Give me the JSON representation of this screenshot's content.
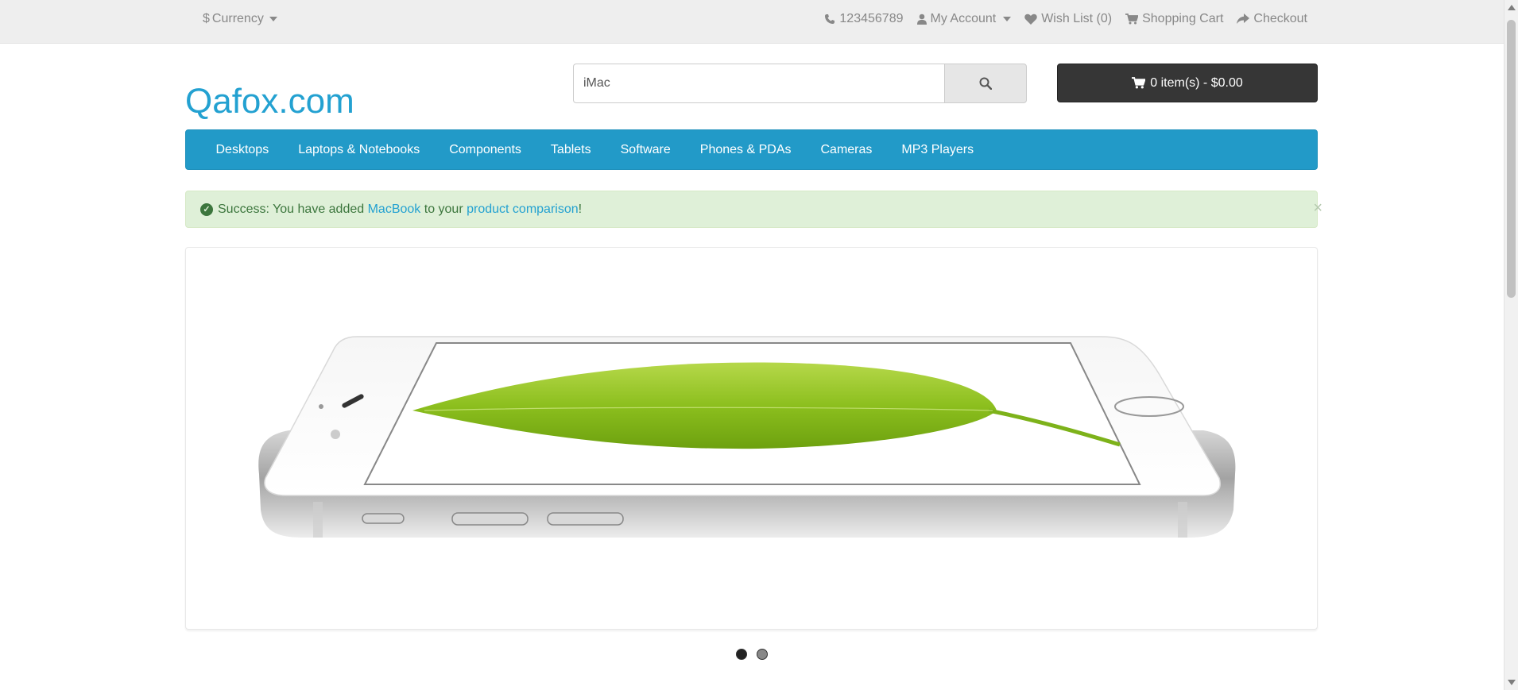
{
  "topbar": {
    "currency_symbol": "$",
    "currency_label": "Currency",
    "phone": "123456789",
    "my_account": "My Account",
    "wishlist": "Wish List (0)",
    "shopping_cart": "Shopping Cart",
    "checkout": "Checkout"
  },
  "header": {
    "logo": "Qafox.com",
    "search_value": "iMac",
    "cart_button": "0 item(s) - $0.00"
  },
  "nav": {
    "items": [
      "Desktops",
      "Laptops & Notebooks",
      "Components",
      "Tablets",
      "Software",
      "Phones & PDAs",
      "Cameras",
      "MP3 Players"
    ]
  },
  "alert": {
    "prefix": "Success: You have added ",
    "product_link": "MacBook",
    "middle": " to your ",
    "comparison_link": "product comparison",
    "suffix": "!",
    "close": "×"
  },
  "colors": {
    "brand": "#23a1d1",
    "nav_bg": "#229ac8",
    "alert_bg": "#dff0d8",
    "alert_text": "#3c763d",
    "cart_button_bg": "#363636"
  }
}
